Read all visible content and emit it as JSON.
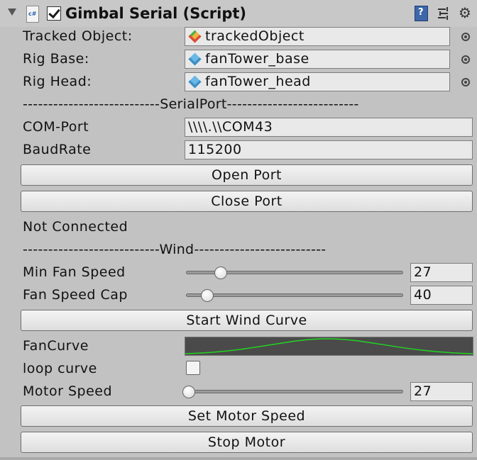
{
  "component": {
    "title": "Gimbal Serial (Script)",
    "enabled": true,
    "icons": [
      "foldout-arrow-icon",
      "csharp-script-icon",
      "help-book-icon",
      "preset-icon",
      "gear-icon"
    ]
  },
  "fields": {
    "tracked_object": {
      "label": "Tracked Object:",
      "value": "trackedObject",
      "icon": "multicolor-cube-icon"
    },
    "rig_base": {
      "label": "Rig Base:",
      "value": "fanTower_base",
      "icon": "blue-cube-icon"
    },
    "rig_head": {
      "label": "Rig Head:",
      "value": "fanTower_head",
      "icon": "blue-cube-icon"
    }
  },
  "serial": {
    "separator": "---------------------------SerialPort--------------------------",
    "com_port_label": "COM-Port",
    "com_port_value": "\\\\\\\\.\\\\COM43",
    "baud_label": "BaudRate",
    "baud_value": "115200",
    "open_label": "Open Port",
    "close_label": "Close Port",
    "status": "Not Connected"
  },
  "wind": {
    "separator": "---------------------------Wind--------------------------",
    "min_fan_label": "Min Fan Speed",
    "min_fan_value": "27",
    "fan_cap_label": "Fan Speed Cap",
    "fan_cap_value": "40",
    "start_curve_label": "Start Wind Curve",
    "fan_curve_label": "FanCurve",
    "loop_label": "loop curve",
    "loop_checked": false,
    "motor_label": "Motor Speed",
    "motor_value": "27",
    "set_motor_label": "Set Motor Speed",
    "stop_motor_label": "Stop Motor"
  },
  "colors": {
    "panel": "#c2c2c2",
    "curve_bg": "#4a4a4a",
    "curve_line": "#22d422",
    "help_icon": "#3d67a8"
  }
}
